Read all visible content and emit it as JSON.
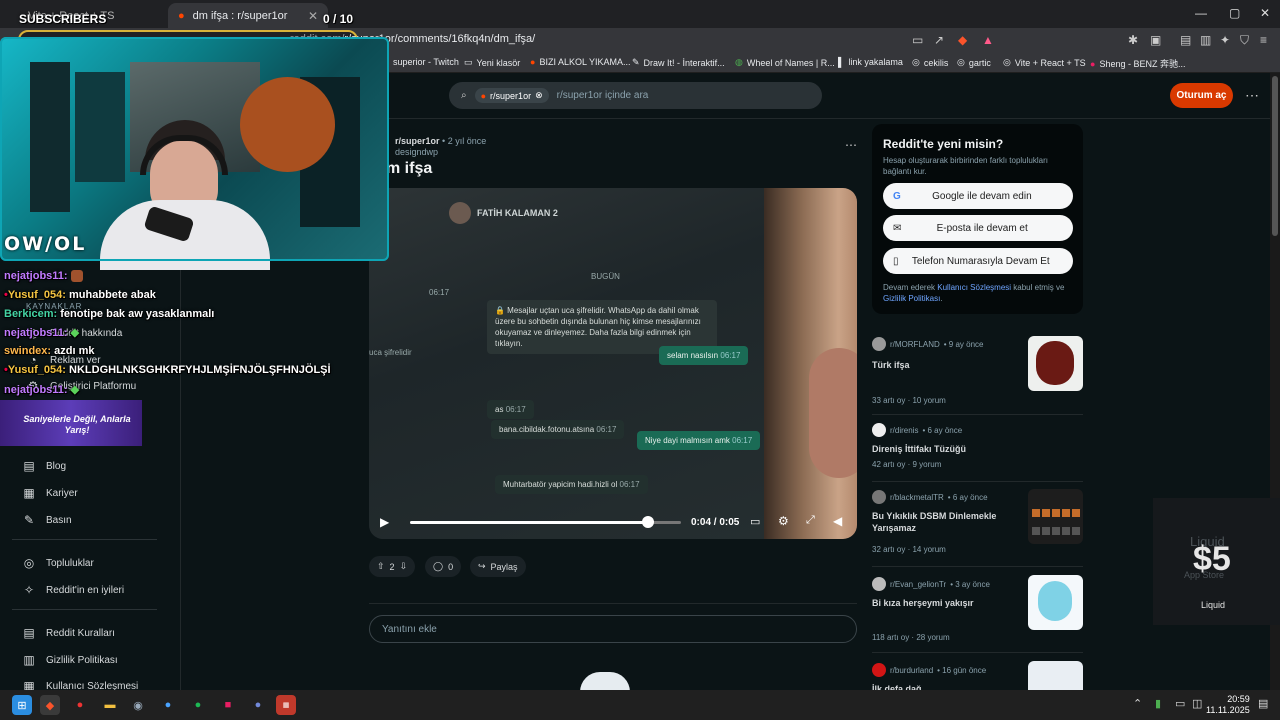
{
  "browser": {
    "tab_inactive": "Vite + React + TS",
    "tab_active": "dm ifşa : r/super1or",
    "tab_close": "✕",
    "url_host": "reddit.com/",
    "url_path": "r/super1or/comments/16fkq4n/dm_ifşa/",
    "bookmarks": [
      "superior - Twitch",
      "Yeni klasör",
      "BIZI ALKOL YIKAMA...",
      "Draw It! - İnteraktif...",
      "Wheel of Names | R...",
      "link yakalama",
      "cekilis",
      "gartic",
      "Vite + React + TS",
      "Sheng - BENZ 奔驰..."
    ]
  },
  "reddit": {
    "search_chip": "r/super1or",
    "search_placeholder": "r/super1or içinde ara",
    "login_label": "Oturum aç",
    "sidebar": {
      "sources_header": "KAYNAKLAR",
      "about": "Reddit hakkında",
      "advertise": "Reklam ver",
      "developer": "Geliştirici Platformu",
      "blog": "Blog",
      "careers": "Kariyer",
      "press": "Basın",
      "communities": "Topluluklar",
      "best": "Reddit'in en iyileri",
      "rules": "Reddit Kuralları",
      "privacy": "Gizlilik Politikası",
      "agreement": "Kullanıcı Sözleşmesi"
    },
    "post": {
      "subreddit": "r/super1or",
      "time": "• 2 yıl önce",
      "author": "designdwp",
      "title": "m ifşa",
      "video_time": "0:04 / 0:05",
      "video_progress": 0.8,
      "votes": "2",
      "comments": "0",
      "share": "Paylaş",
      "comment_placeholder": "Yanıtını ekle",
      "video_chat": {
        "contact": "FATİH KALAMAN 2",
        "date": "BUGÜN",
        "security_notice": "🔒 Mesajlar uçtan uca şifrelidir. WhatsApp da dahil olmak üzere bu sohbetin dışında bulunan hiç kimse mesajlarınızı okuyamaz ve dinleyemez. Daha fazla bilgi edinmek için tıklayın.",
        "messages": [
          "selam nasılsın",
          "as",
          "bana.cibildak.fotonu.atsına",
          "Niye dayi malmısın amk",
          "Muhtarbatör yapicim hadi.hizli ol"
        ],
        "times": [
          "06:17",
          "06:17",
          "06:17",
          "06:17",
          "06:17",
          "06:17"
        ],
        "left_label": "uca şifrelidir"
      }
    },
    "new_card": {
      "title": "Reddit'te yeni misin?",
      "subtitle": "Hesap oluşturarak birbirinden farklı toplulukları bağlantı kur.",
      "google": "Google ile devam edin",
      "email": "E-posta ile devam et",
      "phone": "Telefon Numarasıyla Devam Et",
      "terms_prefix": "Devam ederek ",
      "terms_link1": "Kullanıcı Sözleşmesi",
      "terms_mid": " kabul etmiş ve ",
      "terms_link2": "Gizlilik Politikası",
      "terms_suffix": "."
    },
    "related": [
      {
        "sub": "r/MORFLAND",
        "time": "• 9 ay önce",
        "title": "Türk ifşa",
        "stats": "33 artı oy  ·  10 yorum"
      },
      {
        "sub": "r/direnis",
        "time": "• 6 ay önce",
        "title": "Direniş İttifakı Tüzüğü",
        "stats": "42 artı oy  ·  9 yorum"
      },
      {
        "sub": "r/blackmetalTR",
        "time": "• 6 ay önce",
        "title": "Bu Yıkıklık DSBM Dinlemekle Yarışamaz",
        "stats": "32 artı oy  ·  14 yorum"
      },
      {
        "sub": "r/Evan_gelionTr",
        "time": "• 3 ay önce",
        "title": "Bi kıza herşeymi yakışır",
        "stats": "118 artı oy  ·  28 yorum"
      },
      {
        "sub": "r/burdurland",
        "time": "• 16 gün önce",
        "title": "İlk defa dağ...",
        "stats": ""
      }
    ]
  },
  "stream": {
    "subscribers_label": "SUBSCRIBERS",
    "subscriber_count": "0 / 10",
    "cam_logo": "OW/OL",
    "banner": "Saniyelerle Değil, Anlarla Yarış!",
    "chat": [
      {
        "user": "nejatjobs11:",
        "msg": "",
        "color": "#c17bff"
      },
      {
        "user": "Yusuf_054:",
        "msg": "muhabbete abak",
        "color": "#f5c542"
      },
      {
        "user": "Berkicem:",
        "msg": "fenotipe bak aw yasaklanmalı",
        "color": "#44d4a4"
      },
      {
        "user": "nejatjobs11:",
        "msg": "",
        "color": "#c17bff"
      },
      {
        "user": "swindex:",
        "msg": "azdı mk",
        "color": "#ffb84d"
      },
      {
        "user": "Yusuf_054:",
        "msg": "NKLDGHLNKSGHKRFYHJLMŞİFNJÖLŞFHNJÖLŞİ",
        "color": "#f5c542"
      },
      {
        "user": "nejatjobs11:",
        "msg": "",
        "color": "#c17bff"
      }
    ],
    "liquid_price": "$5",
    "liquid_name": "Liquid",
    "liquid_ghost": "Liquid",
    "liquid_ghost2": "App Store"
  },
  "taskbar": {
    "time": "20:59",
    "date": "11.11.2025"
  },
  "colors": {
    "accent": "#d93900",
    "link": "#6fa5ff",
    "cam_border": "#0ea5b5"
  }
}
